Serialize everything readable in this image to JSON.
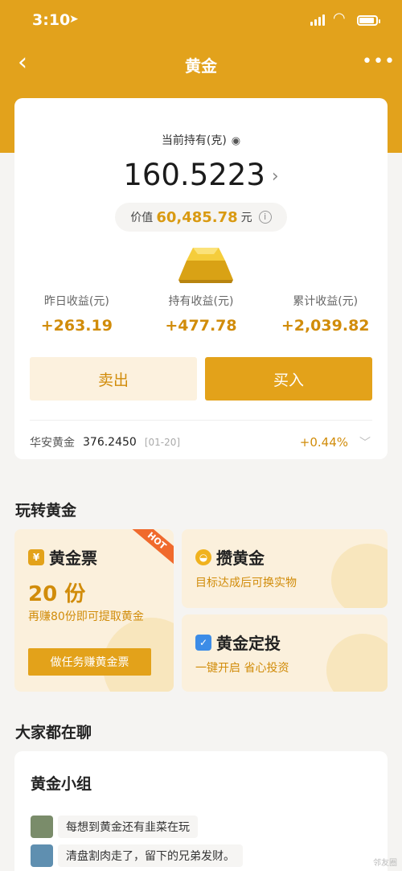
{
  "status_bar": {
    "time": "3:10",
    "location_icon": "location-arrow-icon",
    "wifi_icon": "wifi-icon"
  },
  "nav": {
    "back": "‹",
    "title": "黄金",
    "more": "•••"
  },
  "holding": {
    "label": "当前持有(克)",
    "grams": "160.5223",
    "value_label": "价值",
    "value": "60,485.78",
    "value_unit": "元"
  },
  "stats": [
    {
      "label": "昨日收益(元)",
      "value": "+263.19"
    },
    {
      "label": "持有收益(元)",
      "value": "+477.78"
    },
    {
      "label": "累计收益(元)",
      "value": "+2,039.82"
    }
  ],
  "actions": {
    "sell": "卖出",
    "buy": "买入"
  },
  "quote": {
    "name": "华安黄金",
    "price": "376.2450",
    "date": "[01-20]",
    "change": "+0.44%"
  },
  "play_section": {
    "title": "玩转黄金"
  },
  "tiles": {
    "ticket": {
      "title": "黄金票",
      "hot": "HOT",
      "qty": "20 份",
      "sub": "再赚80份即可提取黄金",
      "button": "做任务赚黄金票"
    },
    "save": {
      "title": "攒黄金",
      "sub": "目标达成后可换实物"
    },
    "plan": {
      "title": "黄金定投",
      "sub": "一键开启 省心投资"
    }
  },
  "chat_section": {
    "title": "大家都在聊"
  },
  "chat": {
    "group_title": "黄金小组",
    "messages": [
      "每想到黄金还有韭菜在玩",
      "清盘割肉走了，留下的兄弟发财。"
    ]
  },
  "watermark": "邻友圈",
  "colors": {
    "brand": "#e2a21c",
    "accent_text": "#d18c0a",
    "hot": "#f06a2d"
  }
}
